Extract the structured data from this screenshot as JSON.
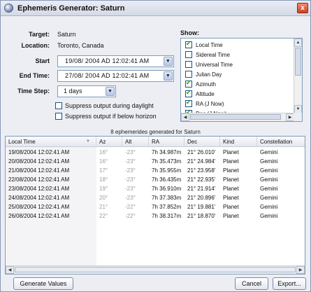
{
  "window": {
    "title": "Ephemeris Generator: Saturn",
    "close_glyph": "x"
  },
  "form": {
    "target_label": "Target:",
    "target_value": "Saturn",
    "location_label": "Location:",
    "location_value": "Toronto, Canada",
    "start_label": "Start",
    "start_value": "19/08/ 2004 AD  12:02:41 AM",
    "end_label": "End Time:",
    "end_value": "27/08/ 2004 AD  12:02:41 AM",
    "timestep_label": "Time Step:",
    "timestep_value": "1 days",
    "suppress_daylight_label": "Suppress output during daylight",
    "suppress_daylight_checked": false,
    "suppress_horizon_label": "Suppress output if below horizon",
    "suppress_horizon_checked": false
  },
  "show": {
    "label": "Show:",
    "items": [
      {
        "label": "Local Time",
        "checked": true
      },
      {
        "label": "Sidereal Time",
        "checked": false
      },
      {
        "label": "Universal Time",
        "checked": false
      },
      {
        "label": "Julian Day",
        "checked": false
      },
      {
        "label": "Azimuth",
        "checked": true
      },
      {
        "label": "Altitude",
        "checked": true
      },
      {
        "label": "RA (J Now)",
        "checked": true
      },
      {
        "label": "Dec (J Now)",
        "checked": true
      }
    ]
  },
  "status": "8 ephemerides generated for Saturn",
  "table": {
    "columns": [
      "Local Time",
      "Az",
      "Alt",
      "RA",
      "Dec",
      "Kind",
      "Constellation"
    ],
    "rows": [
      [
        "19/08/2004 12:02:41 AM",
        "16°",
        "-23°",
        "7h 34.987m",
        "21° 26.010'",
        "Planet",
        "Gemini"
      ],
      [
        "20/08/2004 12:02:41 AM",
        "16°",
        "-23°",
        "7h 35.473m",
        "21° 24.984'",
        "Planet",
        "Gemini"
      ],
      [
        "21/08/2004 12:02:41 AM",
        "17°",
        "-23°",
        "7h 35.955m",
        "21° 23.958'",
        "Planet",
        "Gemini"
      ],
      [
        "22/08/2004 12:02:41 AM",
        "18°",
        "-23°",
        "7h 36.435m",
        "21° 22.935'",
        "Planet",
        "Gemini"
      ],
      [
        "23/08/2004 12:02:41 AM",
        "19°",
        "-23°",
        "7h 36.910m",
        "21° 21.914'",
        "Planet",
        "Gemini"
      ],
      [
        "24/08/2004 12:02:41 AM",
        "20°",
        "-23°",
        "7h 37.383m",
        "21° 20.896'",
        "Planet",
        "Gemini"
      ],
      [
        "25/08/2004 12:02:41 AM",
        "21°",
        "-22°",
        "7h 37.852m",
        "21° 19.881'",
        "Planet",
        "Gemini"
      ],
      [
        "26/08/2004 12:02:41 AM",
        "22°",
        "-22°",
        "7h 38.317m",
        "21° 18.870'",
        "Planet",
        "Gemini"
      ]
    ]
  },
  "buttons": {
    "generate": "Generate Values",
    "cancel": "Cancel",
    "export": "Export..."
  },
  "icons": {
    "window": "app-icon",
    "close": "close-icon",
    "dropdown": "chevron-down-icon",
    "sort": "sort-arrow-icon"
  },
  "colors": {
    "accent": "#7f9db9",
    "check": "#21a121",
    "close": "#c8412a"
  }
}
